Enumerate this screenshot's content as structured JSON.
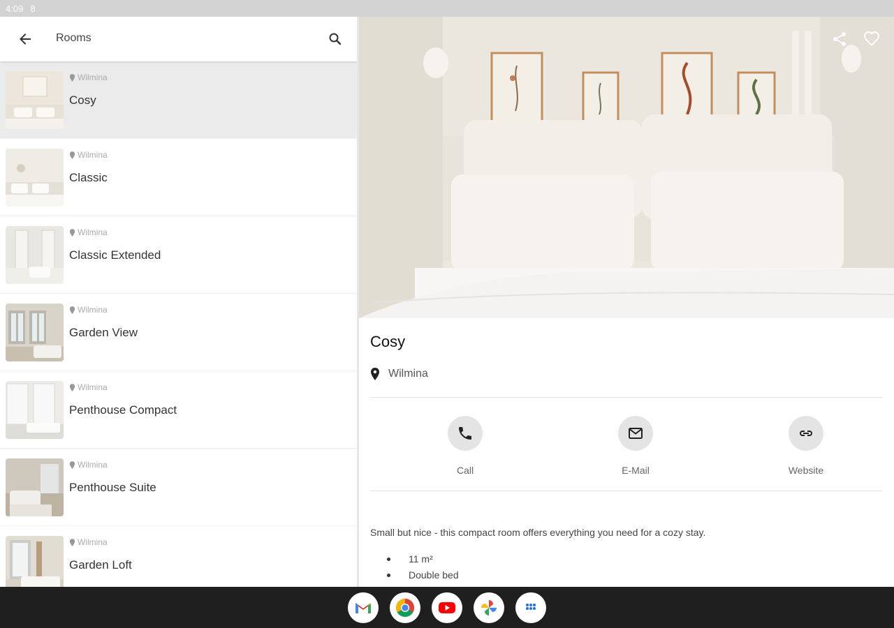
{
  "status_bar": {
    "time": "4:09",
    "extra": "8"
  },
  "app_bar": {
    "title": "Rooms",
    "back_icon": "arrow-left-icon",
    "search_icon": "search-icon"
  },
  "rooms": [
    {
      "location": "Wilmina",
      "name": "Cosy",
      "selected": true
    },
    {
      "location": "Wilmina",
      "name": "Classic"
    },
    {
      "location": "Wilmina",
      "name": "Classic Extended"
    },
    {
      "location": "Wilmina",
      "name": "Garden View"
    },
    {
      "location": "Wilmina",
      "name": "Penthouse Compact"
    },
    {
      "location": "Wilmina",
      "name": "Penthouse Suite"
    },
    {
      "location": "Wilmina",
      "name": "Garden Loft"
    }
  ],
  "detail": {
    "title": "Cosy",
    "location": "Wilmina",
    "actions": {
      "call": "Call",
      "email": "E-Mail",
      "website": "Website"
    },
    "description": "Small but nice - this compact room offers everything you need for a cozy stay.",
    "features": [
      "11 m²",
      "Double bed"
    ]
  },
  "dock": [
    "gmail-icon",
    "chrome-icon",
    "youtube-icon",
    "photos-icon",
    "apps-icon"
  ],
  "colors": {
    "selected_row": "#ebebeb",
    "action_circle": "#e4e4e4",
    "status_bar": "#d2d2d2",
    "nav_bar": "#1f1f1f"
  }
}
